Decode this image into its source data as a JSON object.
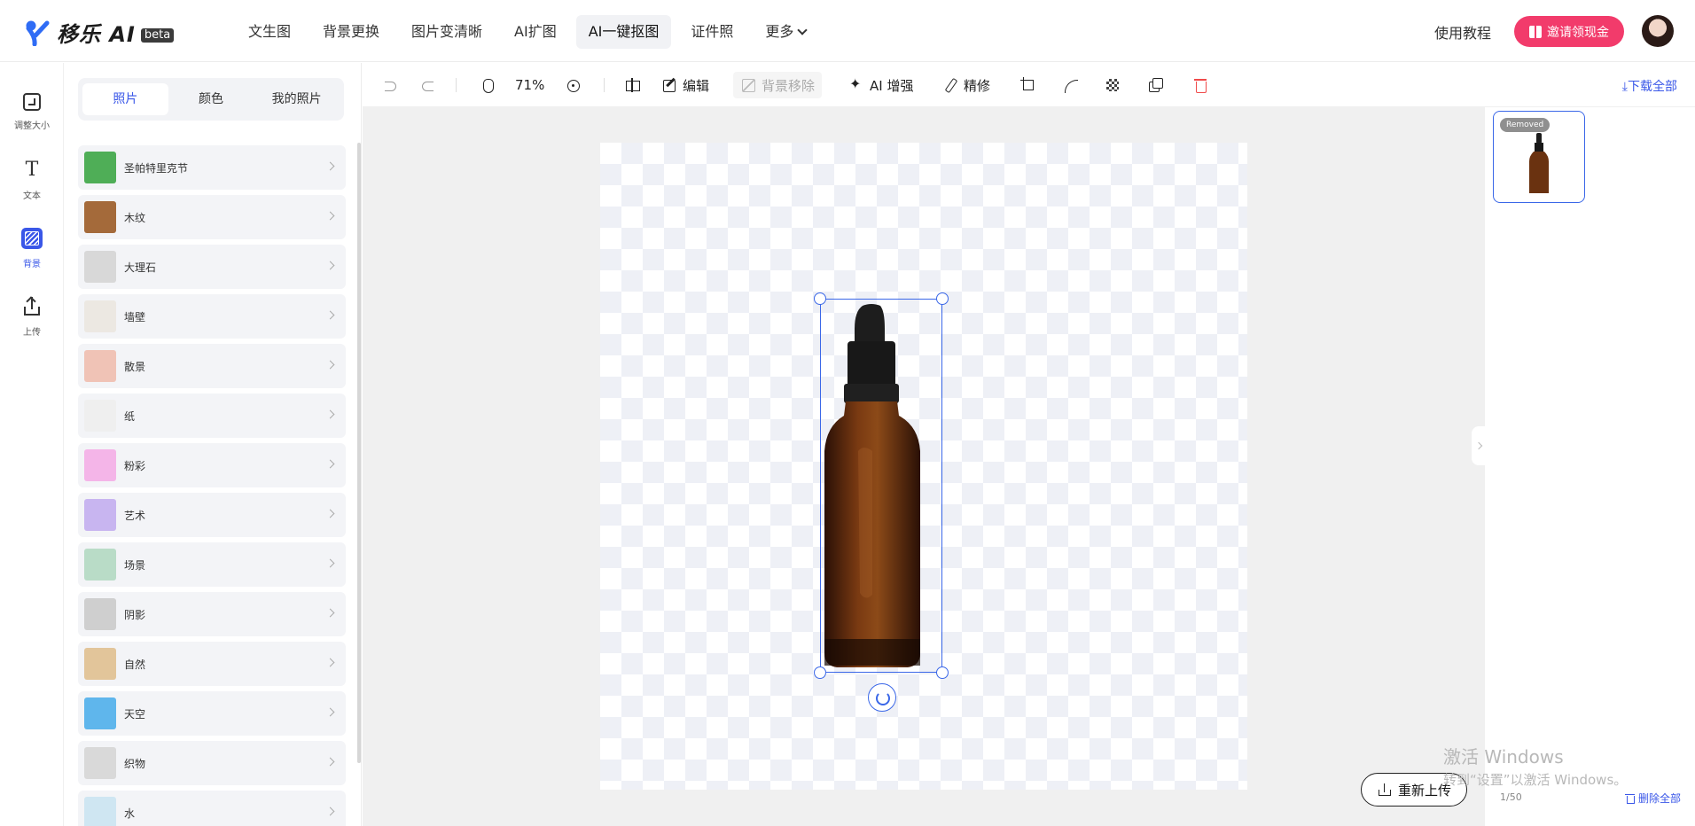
{
  "app": {
    "logo_text": "移乐 AI",
    "logo_badge": "beta"
  },
  "nav": {
    "items": [
      "文生图",
      "背景更换",
      "图片变清晰",
      "AI扩图",
      "AI一键抠图",
      "证件照",
      "更多"
    ],
    "active_index": 4
  },
  "header": {
    "tutorial": "使用教程",
    "invite": "邀请领现金"
  },
  "rail": {
    "items": [
      "调整大小",
      "文本",
      "背景",
      "上传"
    ],
    "active_index": 2
  },
  "panel": {
    "tabs": [
      "照片",
      "颜色",
      "我的照片"
    ],
    "active_tab": 0,
    "categories": [
      {
        "label": "圣帕特里克节",
        "color": "#4fae57"
      },
      {
        "label": "木纹",
        "color": "#a46a3a"
      },
      {
        "label": "大理石",
        "color": "#d8d8d8"
      },
      {
        "label": "墙壁",
        "color": "#ece8e2"
      },
      {
        "label": "散景",
        "color": "#f0c3b6"
      },
      {
        "label": "纸",
        "color": "#efefef"
      },
      {
        "label": "粉彩",
        "color": "#f4b5e8"
      },
      {
        "label": "艺术",
        "color": "#c8b5f0"
      },
      {
        "label": "场景",
        "color": "#b9dcc7"
      },
      {
        "label": "阴影",
        "color": "#cfcfcf"
      },
      {
        "label": "自然",
        "color": "#e2c59a"
      },
      {
        "label": "天空",
        "color": "#5fb6ec"
      },
      {
        "label": "织物",
        "color": "#d9d9d9"
      },
      {
        "label": "水",
        "color": "#cfe6f2"
      }
    ]
  },
  "toolbar": {
    "zoom": "71%",
    "edit": "编辑",
    "remove_bg": "背景移除",
    "ai_enhance": "AI 增强",
    "refine": "精修",
    "download_all": "下载全部"
  },
  "canvas": {
    "reupload": "重新上传"
  },
  "right": {
    "badge": "Removed",
    "counter": "1/50",
    "delete_all": "删除全部"
  },
  "watermark": {
    "line1": "激活 Windows",
    "line2": "转到“设置”以激活 Windows。"
  },
  "colors": {
    "accent": "#3a57e8",
    "invite": "#f23b6b"
  }
}
